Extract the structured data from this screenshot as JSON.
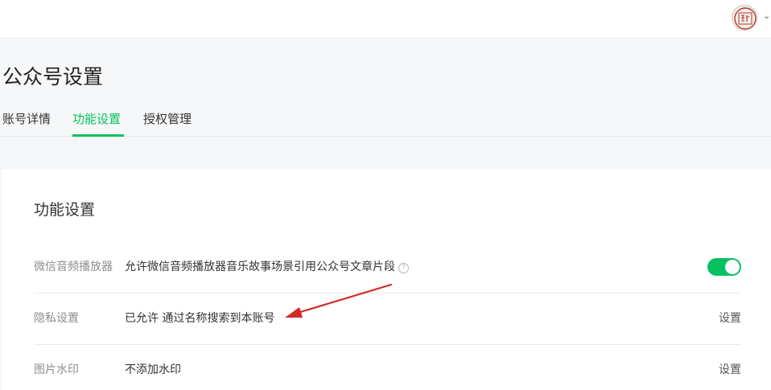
{
  "header": {
    "avatar_icon": "seal-avatar-icon",
    "caret_icon": "chevron-down-icon"
  },
  "page": {
    "title": "公众号设置"
  },
  "tabs": [
    {
      "label": "账号详情",
      "active": false
    },
    {
      "label": "功能设置",
      "active": true
    },
    {
      "label": "授权管理",
      "active": false
    }
  ],
  "panel": {
    "title": "功能设置",
    "rows": [
      {
        "label": "微信音频播放器",
        "value": "允许微信音频播放器音乐故事场景引用公众号文章片段",
        "help_icon": "question-circle-icon",
        "toggle_on": true
      },
      {
        "label": "隐私设置",
        "value": "已允许 通过名称搜索到本账号",
        "action": "设置"
      },
      {
        "label": "图片水印",
        "value": "不添加水印",
        "action": "设置"
      }
    ]
  },
  "colors": {
    "accent": "#07c160",
    "annotation_arrow": "#d42a24"
  }
}
